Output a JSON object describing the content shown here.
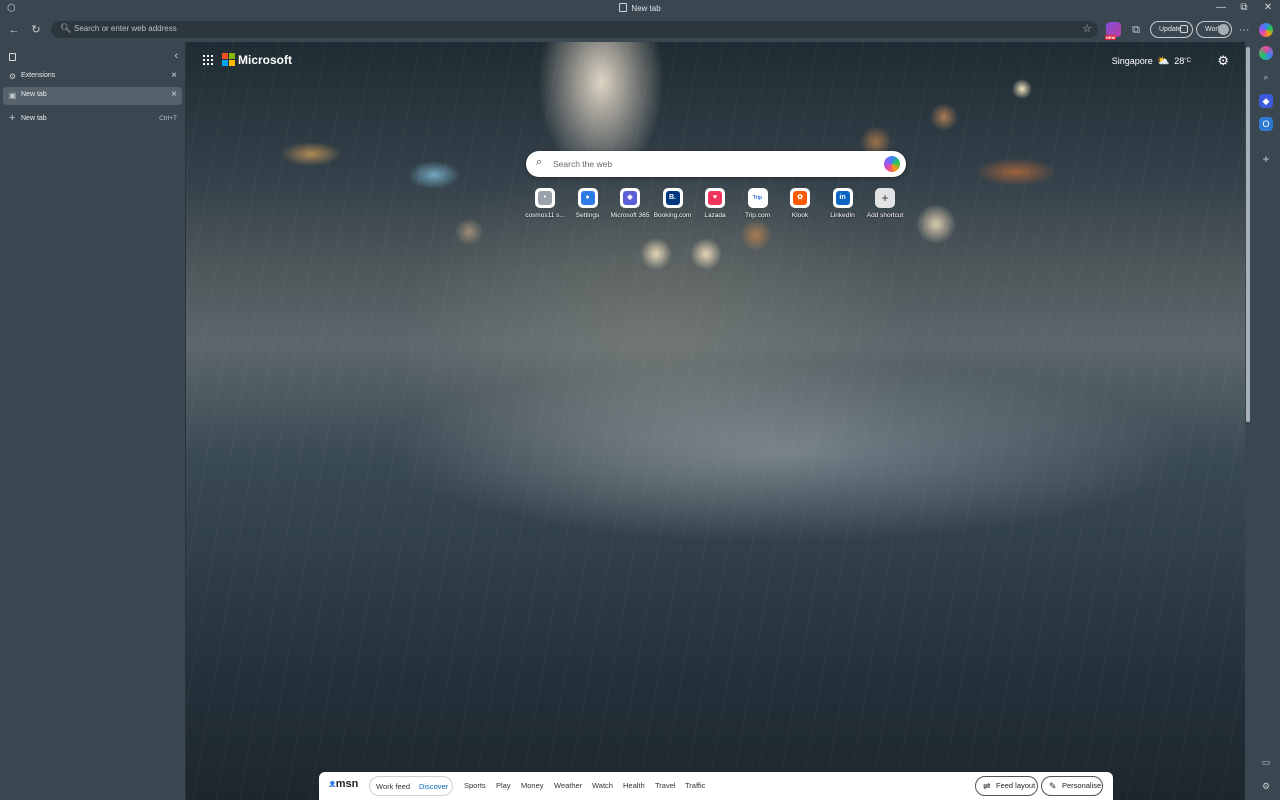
{
  "window": {
    "title": "New tab",
    "controls": {
      "minimize": "—",
      "restore": "⧉",
      "close": "✕"
    }
  },
  "toolbar": {
    "address_placeholder": "Search or enter web address",
    "ext_badge": "NEW",
    "update_label": "Update",
    "profile_label": "Work",
    "more_label": "···"
  },
  "tabs": {
    "items": [
      {
        "label": "Extensions",
        "active": false
      },
      {
        "label": "New tab",
        "active": true
      }
    ],
    "new_tab_label": "New tab",
    "new_tab_shortcut": "Ctrl+T"
  },
  "newtab": {
    "brand": "Microsoft",
    "weather": {
      "location": "Singapore",
      "temperature": "28",
      "unit": "°C"
    },
    "search_placeholder": "Search the web",
    "shortcuts": [
      {
        "label": "cosmos11 s...",
        "icon": "cosmos-icon",
        "color": "#9aa3ab",
        "glyph": "•"
      },
      {
        "label": "Settings",
        "icon": "settings-app-icon",
        "color": "#2f7be5",
        "glyph": "●"
      },
      {
        "label": "Microsoft 365",
        "icon": "m365-icon",
        "color": "#5b5fd6",
        "glyph": "◆"
      },
      {
        "label": "Booking.com",
        "icon": "booking-icon",
        "color": "#003580",
        "glyph": "B."
      },
      {
        "label": "Lazada",
        "icon": "lazada-icon",
        "color": "#f0345b",
        "glyph": "♥"
      },
      {
        "label": "Trip.com",
        "icon": "tripcom-icon",
        "color": "#ffffff",
        "glyph": "Trip"
      },
      {
        "label": "Klook",
        "icon": "klook-icon",
        "color": "#ff5b00",
        "glyph": "✿"
      },
      {
        "label": "LinkedIn",
        "icon": "linkedin-icon",
        "color": "#0a66c2",
        "glyph": "in"
      },
      {
        "label": "Add shortcut",
        "icon": "plus-icon",
        "color": "#ffffff",
        "glyph": "+"
      }
    ]
  },
  "msn": {
    "logo": "msn",
    "feed_tabs": [
      "Work feed",
      "Discover"
    ],
    "active_feed": "Discover",
    "nav": [
      "Sports",
      "Play",
      "Money",
      "Weather",
      "Watch",
      "Health",
      "Travel",
      "Traffic"
    ],
    "feed_layout_label": "Feed layout",
    "personalise_label": "Personalise"
  },
  "colors": {
    "ms_red": "#f25022",
    "ms_green": "#7fba00",
    "ms_blue": "#00a4ef",
    "ms_yellow": "#ffb900",
    "discover_accent": "#0f6cbd"
  }
}
